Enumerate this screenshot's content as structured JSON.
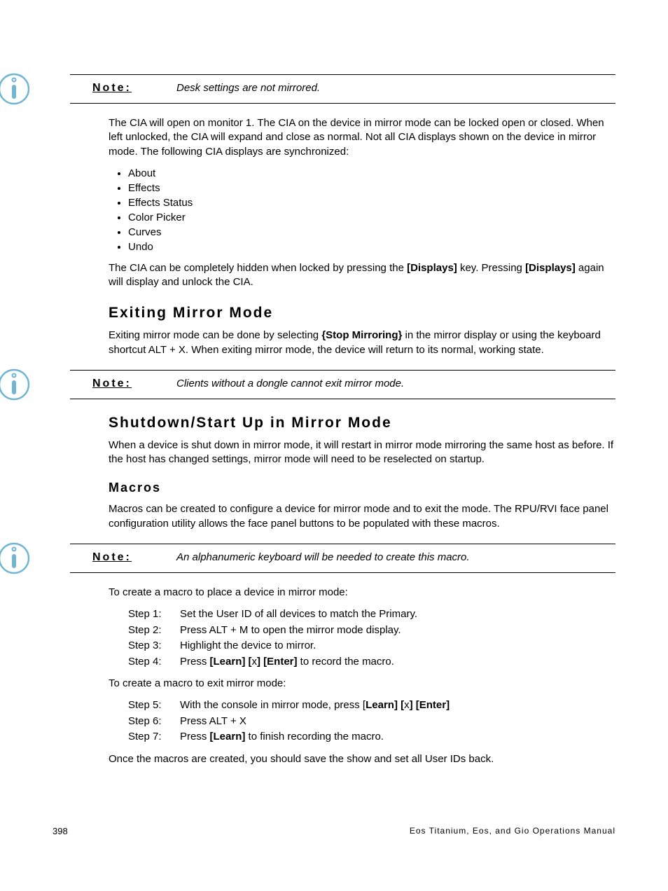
{
  "notes": {
    "label": "Note:",
    "n1_text": "Desk settings are not mirrored.",
    "n2_text": "Clients without a dongle cannot exit mirror mode.",
    "n3_text": "An alphanumeric keyboard will be needed to create this macro."
  },
  "intro": {
    "p1": "The CIA will open on monitor 1. The CIA on the device in mirror mode can be locked open or closed. When left unlocked, the CIA will expand and close as normal. Not all CIA displays shown on the device in mirror mode. The following CIA displays are synchronized:",
    "bullets": [
      "About",
      "Effects",
      "Effects Status",
      "Color Picker",
      "Curves",
      "Undo"
    ],
    "p2_a": "The CIA can be completely hidden when locked by pressing the ",
    "p2_b": "[Displays]",
    "p2_c": " key. Pressing ",
    "p2_d": "[Displays]",
    "p2_e": " again will display and unlock the CIA."
  },
  "exiting": {
    "heading": "Exiting Mirror Mode",
    "p_a": "Exiting mirror mode can be done by selecting ",
    "p_b": "{Stop Mirroring}",
    "p_c": " in the mirror display or using the keyboard shortcut ALT + X. When exiting mirror mode, the device will return to its normal, working state."
  },
  "shutdown": {
    "heading": "Shutdown/Start Up in Mirror Mode",
    "p": "When a device is shut down in mirror mode, it will restart in mirror mode mirroring the same host as before. If the host has changed settings, mirror mode will need to be reselected on startup."
  },
  "macros": {
    "heading": "Macros",
    "p1": "Macros can be created to configure a device for mirror mode and to exit the mode. The RPU/RVI face panel configuration utility allows the face panel buttons to be populated with these macros.",
    "p_intro1": "To create a macro to place a device in mirror mode:",
    "steps1": [
      {
        "label": "Step 1:",
        "t1": "Set the User ID of all devices to match the Primary."
      },
      {
        "label": "Step 2:",
        "t1": "Press ALT + M to open the mirror mode display."
      },
      {
        "label": "Step 3:",
        "t1": "Highlight the device to mirror."
      },
      {
        "label": "Step 4:",
        "t1": "Press ",
        "b1": "[Learn] [",
        "t2": "x",
        "b2": "] [Enter]",
        "t3": " to record the macro."
      }
    ],
    "p_intro2": "To create a macro to exit mirror mode:",
    "steps2": [
      {
        "label": "Step 5:",
        "t1": "With the console in mirror mode, press [",
        "b1": "Learn] [",
        "t2": "x",
        "b2": "] [Enter]"
      },
      {
        "label": "Step 6:",
        "t1": "Press ALT + X"
      },
      {
        "label": "Step 7:",
        "t1": "Press ",
        "b1": "[Learn]",
        "t2": " to finish recording the macro."
      }
    ],
    "p_out": "Once the macros are created, you should save the show and set all User IDs back."
  },
  "footer": {
    "page": "398",
    "manual": "Eos Titanium, Eos, and Gio Operations Manual"
  }
}
